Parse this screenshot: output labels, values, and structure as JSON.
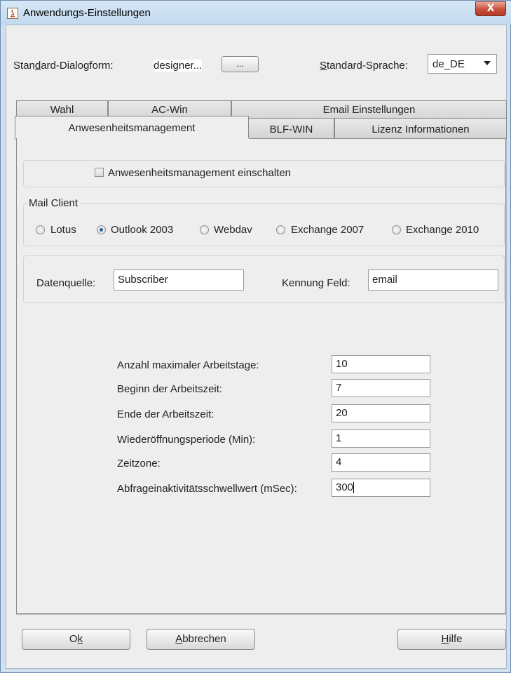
{
  "window": {
    "title": "Anwendungs-Einstellungen",
    "close_symbol": "X"
  },
  "top": {
    "dialog_label_a": "Stan",
    "dialog_label_u": "d",
    "dialog_label_b": "ard-Dialogform:",
    "dialog_value": "designer...",
    "browse_button": "...",
    "lang_label_u": "S",
    "lang_label_b": "tandard-Sprache:",
    "lang_value": "de_DE"
  },
  "tabs": {
    "row1": [
      "Wahl",
      "AC-Win",
      "Email Einstellungen"
    ],
    "row2": [
      "Anwesenheitsmanagement",
      "BLF-WIN",
      "Lizenz Informationen"
    ]
  },
  "presence": {
    "enable_label": "Anwesenheitsmanagement einschalten",
    "enabled": false
  },
  "mail_client": {
    "legend": "Mail Client",
    "options": [
      "Lotus",
      "Outlook 2003",
      "Webdav",
      "Exchange 2007",
      "Exchange 2010"
    ],
    "selected": "Outlook 2003"
  },
  "source": {
    "datasource_label": "Datenquelle:",
    "datasource_value": "Subscriber",
    "key_label": "Kennung Feld:",
    "key_value": "email"
  },
  "settings": [
    {
      "label": "Anzahl maximaler Arbeitstage:",
      "value": "10"
    },
    {
      "label": "Beginn der Arbeitszeit:",
      "value": "7"
    },
    {
      "label": "Ende der Arbeitszeit:",
      "value": "20"
    },
    {
      "label": "Wiederöffnungsperiode (Min):",
      "value": "1"
    },
    {
      "label": "Zeitzone:",
      "value": "4"
    },
    {
      "label": "Abfrageinaktivitätsschwellwert (mSec):",
      "value": "300"
    }
  ],
  "buttons": {
    "ok_a": "O",
    "ok_u": "k",
    "cancel_u": "A",
    "cancel_b": "bbrechen",
    "help_u": "H",
    "help_b": "ilfe"
  },
  "colors": {
    "titlebar": "#c3d9ef",
    "close": "#c8513b",
    "dialog_bg": "#eeeeee",
    "radio_dot": "#2c5f9e"
  }
}
